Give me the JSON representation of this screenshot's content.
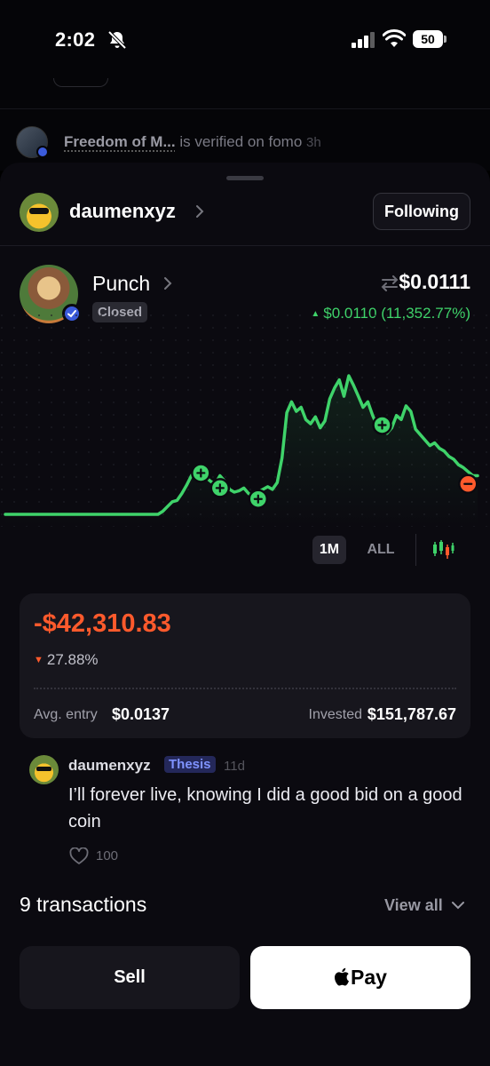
{
  "status_bar": {
    "time": "2:02",
    "battery": "50"
  },
  "notification": {
    "name": "Freedom of M...",
    "text": " is verified on fomo ",
    "time": "3h"
  },
  "header": {
    "username": "daumenxyz",
    "follow_label": "Following"
  },
  "token": {
    "name": "Punch",
    "status": "Closed",
    "price": "$0.0111",
    "change": "$0.0110 (11,352.77%)"
  },
  "chart_data": {
    "type": "line",
    "title": "",
    "xlabel": "",
    "ylabel": "",
    "color": "#3fd36a",
    "x": [
      0,
      1,
      2,
      3,
      4,
      5,
      6,
      7,
      8,
      9,
      10,
      11,
      12,
      13,
      14,
      15,
      16,
      17,
      18,
      19,
      20,
      21,
      22,
      23,
      24,
      25,
      26,
      27,
      28,
      29,
      30,
      31,
      32,
      33,
      34,
      35,
      36,
      37,
      38,
      39,
      40,
      41,
      42,
      43,
      44,
      45,
      46,
      47,
      48,
      49,
      50,
      51,
      52,
      53,
      54,
      55,
      56,
      57,
      58,
      59,
      60,
      61,
      62,
      63,
      64,
      65,
      66,
      67,
      68,
      69,
      70,
      71,
      72,
      73,
      74,
      75,
      76,
      77,
      78,
      79,
      80,
      81,
      82,
      83,
      84,
      85,
      86,
      87,
      88,
      89,
      90,
      91,
      92,
      93,
      94,
      95,
      96,
      97,
      98,
      99
    ],
    "values": [
      0.00138,
      0.00138,
      0.00138,
      0.00138,
      0.00138,
      0.00138,
      0.00138,
      0.00138,
      0.00138,
      0.00138,
      0.00138,
      0.00138,
      0.00138,
      0.00138,
      0.00138,
      0.00138,
      0.00138,
      0.00138,
      0.00138,
      0.00138,
      0.00138,
      0.00138,
      0.00138,
      0.00138,
      0.00138,
      0.00138,
      0.00138,
      0.00138,
      0.00138,
      0.00138,
      0.00138,
      0.00138,
      0.00138,
      0.0016,
      0.00195,
      0.0023,
      0.0024,
      0.0029,
      0.0035,
      0.0042,
      0.0047,
      0.0044,
      0.0041,
      0.0038,
      0.0036,
      0.0042,
      0.0038,
      0.0032,
      0.003,
      0.0031,
      0.0033,
      0.0029,
      0.0027,
      0.003,
      0.0032,
      0.0034,
      0.0032,
      0.0037,
      0.0055,
      0.0088,
      0.0096,
      0.0089,
      0.0092,
      0.0083,
      0.008,
      0.0085,
      0.0077,
      0.0082,
      0.0098,
      0.0106,
      0.0112,
      0.01,
      0.0115,
      0.0108,
      0.01,
      0.0092,
      0.0096,
      0.0086,
      0.0078,
      0.008,
      0.0073,
      0.0077,
      0.0086,
      0.0083,
      0.0093,
      0.0089,
      0.0076,
      0.0072,
      0.0068,
      0.0064,
      0.0066,
      0.0062,
      0.006,
      0.0056,
      0.0054,
      0.005,
      0.0048,
      0.0045,
      0.0042,
      0.0042
    ],
    "trades": [
      {
        "side": "buy",
        "x": 41,
        "value": 0.0044
      },
      {
        "side": "buy",
        "x": 45,
        "value": 0.0033
      },
      {
        "side": "buy",
        "x": 53,
        "value": 0.0025
      },
      {
        "side": "buy",
        "x": 79,
        "value": 0.0079
      },
      {
        "side": "sell",
        "x": 97,
        "value": 0.0036
      }
    ]
  },
  "range": {
    "selected": "1M",
    "other": "ALL"
  },
  "position": {
    "pnl": "-$42,310.83",
    "pnl_pct": "27.88%",
    "avg_entry_label": "Avg. entry",
    "avg_entry": "$0.0137",
    "invested_label": "Invested",
    "invested": "$151,787.67"
  },
  "comment": {
    "author": "daumenxyz",
    "badge": "Thesis",
    "time": "11d",
    "text": "I’ll forever live, knowing I did a good bid on a good coin",
    "likes": "100"
  },
  "transactions": {
    "title": "9 transactions",
    "view_all": "View all"
  },
  "actions": {
    "sell": "Sell",
    "pay": "Pay"
  },
  "colors": {
    "positive": "#3fd36a",
    "negative": "#ff5a2c",
    "badge": "#7f93ff"
  }
}
